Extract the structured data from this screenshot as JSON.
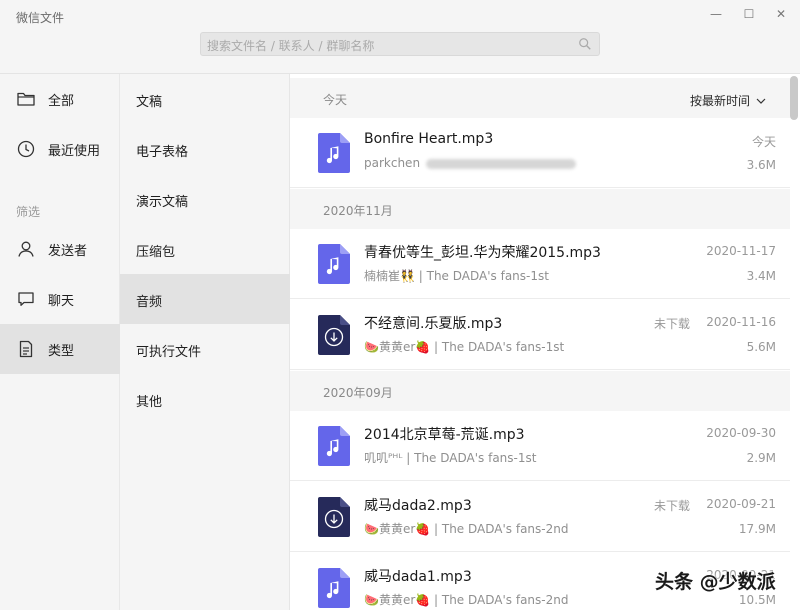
{
  "window": {
    "title": "微信文件",
    "min_glyph": "—",
    "max_glyph": "☐",
    "close_glyph": "✕"
  },
  "search": {
    "placeholder": "搜索文件名 / 联系人 / 群聊名称"
  },
  "sidebar": {
    "items": [
      {
        "label": "全部",
        "icon": "folder-icon"
      },
      {
        "label": "最近使用",
        "icon": "clock-icon"
      }
    ],
    "filter_label": "筛选",
    "filter_items": [
      {
        "label": "发送者",
        "icon": "person-icon"
      },
      {
        "label": "聊天",
        "icon": "chat-bubble-icon"
      },
      {
        "label": "类型",
        "icon": "document-icon",
        "active": true
      }
    ]
  },
  "types": [
    {
      "label": "文稿"
    },
    {
      "label": "电子表格"
    },
    {
      "label": "演示文稿"
    },
    {
      "label": "压缩包"
    },
    {
      "label": "音频",
      "active": true
    },
    {
      "label": "可执行文件"
    },
    {
      "label": "其他"
    }
  ],
  "sort_label": "按最新时间",
  "groups": [
    {
      "label": "今天"
    },
    {
      "label": "2020年11月"
    },
    {
      "label": "2020年09月"
    }
  ],
  "files": [
    {
      "name": "Bonfire Heart.mp3",
      "meta": "parkchen",
      "meta_blurred": true,
      "date": "今天",
      "status": "",
      "size": "3.6M",
      "downloaded": true
    },
    {
      "name": "青春优等生_彭坦.华为荣耀2015.mp3",
      "meta": "楠楠崔👯 | The DADA's fans-1st",
      "date": "2020-11-17",
      "status": "",
      "size": "3.4M",
      "downloaded": true
    },
    {
      "name": "不经意间.乐夏版.mp3",
      "meta": "🍉黄黄er🍓 | The DADA's fans-1st",
      "date": "2020-11-16",
      "status": "未下载",
      "size": "5.6M",
      "downloaded": false
    },
    {
      "name": "2014北京草莓-荒诞.mp3",
      "meta": "叽叽ᴾᴴᴸ | The DADA's fans-1st",
      "date": "2020-09-30",
      "status": "",
      "size": "2.9M",
      "downloaded": true
    },
    {
      "name": "威马dada2.mp3",
      "meta": "🍉黄黄er🍓 | The DADA's fans-2nd",
      "date": "2020-09-21",
      "status": "未下载",
      "size": "17.9M",
      "downloaded": false
    },
    {
      "name": "威马dada1.mp3",
      "meta": "🍉黄黄er🍓 | The DADA's fans-2nd",
      "date": "2020-09-21",
      "status": "",
      "size": "10.5M",
      "downloaded": true
    }
  ],
  "watermark": "头条 @少数派",
  "colors": {
    "audio_icon": "#6466ea",
    "undownloaded_icon": "#262a5a",
    "active_bg": "#e2e2e2"
  }
}
